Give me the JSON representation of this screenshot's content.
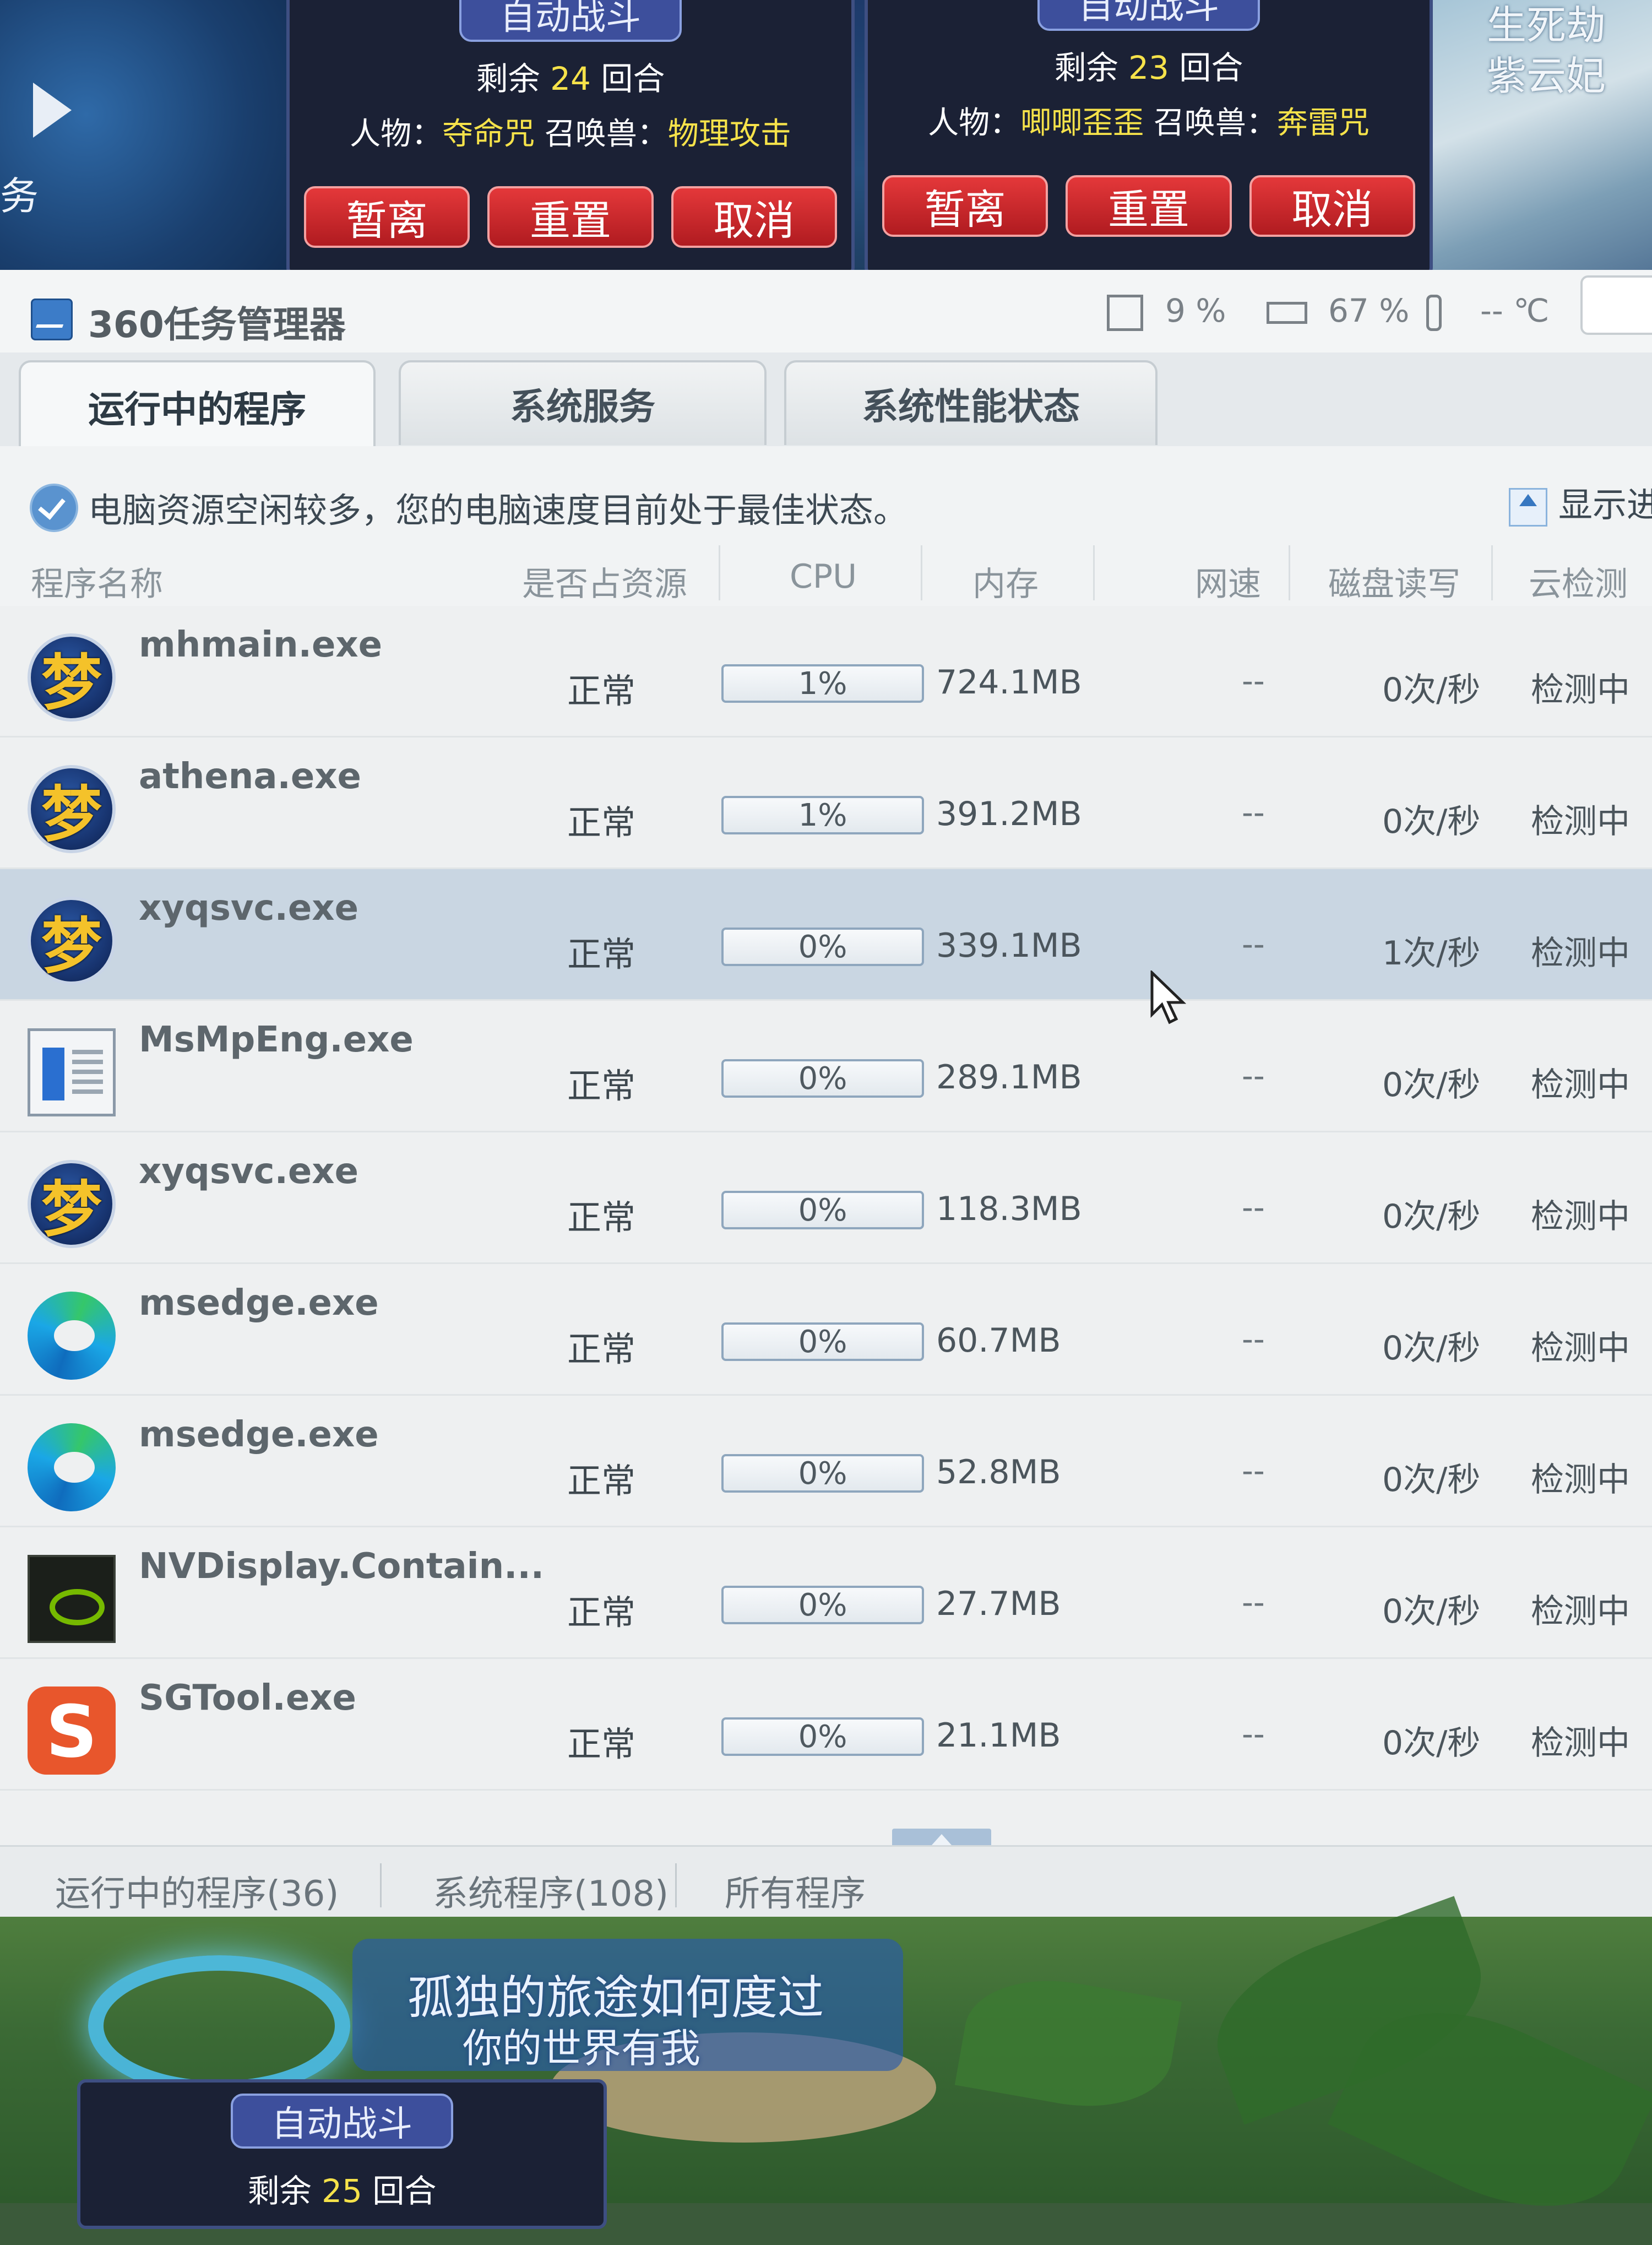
{
  "game": {
    "panel1": {
      "title": "自动战斗",
      "rounds_prefix": "剩余",
      "rounds": "24",
      "rounds_suffix": "回合",
      "char_label": "人物：",
      "char_value": "夺命咒",
      "pet_label": "召唤兽：",
      "pet_value": "物理攻击",
      "buttons": [
        "暂离",
        "重置",
        "取消"
      ]
    },
    "panel2": {
      "title": "自动战斗",
      "rounds_prefix": "剩余",
      "rounds": "23",
      "rounds_suffix": "回合",
      "char_label": "人物：",
      "char_value": "唧唧歪歪",
      "pet_label": "召唤兽：",
      "pet_value": "奔雷咒",
      "buttons": [
        "暂离",
        "重置",
        "取消"
      ]
    },
    "panel3": {
      "title": "自动战斗",
      "rounds_prefix": "剩余",
      "rounds": "25",
      "rounds_suffix": "回合"
    },
    "side_text": "务",
    "corner_text": [
      "生死劫",
      "紫云妃"
    ],
    "bottom_banner": [
      "孤独的旅途如何度过",
      "你的世界有我"
    ]
  },
  "window": {
    "title": "360任务管理器",
    "cpu_usage": "9 %",
    "memory_usage": "67 %",
    "temperature": "-- ℃",
    "tabs": [
      "运行中的程序",
      "系统服务",
      "系统性能状态"
    ],
    "active_tab": 0,
    "status_message": "电脑资源空闲较多，您的电脑速度目前处于最佳状态。",
    "show_toggle": "显示进",
    "columns": [
      "程序名称",
      "是否占资源",
      "CPU",
      "内存",
      "网速",
      "磁盘读写",
      "云检测"
    ],
    "processes": [
      {
        "name": "mhmain.exe",
        "icon": "game-icon",
        "resource": "正常",
        "cpu": "1%",
        "memory": "724.1MB",
        "net": "--",
        "disk": "0次/秒",
        "cloud": "检测中"
      },
      {
        "name": "athena.exe",
        "icon": "game-icon",
        "resource": "正常",
        "cpu": "1%",
        "memory": "391.2MB",
        "net": "--",
        "disk": "0次/秒",
        "cloud": "检测中"
      },
      {
        "name": "xyqsvc.exe",
        "icon": "game-icon",
        "resource": "正常",
        "cpu": "0%",
        "memory": "339.1MB",
        "net": "--",
        "disk": "1次/秒",
        "cloud": "检测中",
        "selected": true
      },
      {
        "name": "MsMpEng.exe",
        "icon": "defender-icon",
        "resource": "正常",
        "cpu": "0%",
        "memory": "289.1MB",
        "net": "--",
        "disk": "0次/秒",
        "cloud": "检测中"
      },
      {
        "name": "xyqsvc.exe",
        "icon": "game-icon",
        "resource": "正常",
        "cpu": "0%",
        "memory": "118.3MB",
        "net": "--",
        "disk": "0次/秒",
        "cloud": "检测中"
      },
      {
        "name": "msedge.exe",
        "icon": "edge-icon",
        "resource": "正常",
        "cpu": "0%",
        "memory": "60.7MB",
        "net": "--",
        "disk": "0次/秒",
        "cloud": "检测中"
      },
      {
        "name": "msedge.exe",
        "icon": "edge-icon",
        "resource": "正常",
        "cpu": "0%",
        "memory": "52.8MB",
        "net": "--",
        "disk": "0次/秒",
        "cloud": "检测中"
      },
      {
        "name": "NVDisplay.Contain...",
        "icon": "nvidia-icon",
        "resource": "正常",
        "cpu": "0%",
        "memory": "27.7MB",
        "net": "--",
        "disk": "0次/秒",
        "cloud": "检测中"
      },
      {
        "name": "SGTool.exe",
        "icon": "sogou-icon",
        "resource": "正常",
        "cpu": "0%",
        "memory": "21.1MB",
        "net": "--",
        "disk": "0次/秒",
        "cloud": "检测中"
      }
    ],
    "footer_tabs": [
      "运行中的程序(36)",
      "系统程序(108)",
      "所有程序"
    ],
    "colors": {
      "selected_row": "#c9d6e2",
      "accent": "#3777c0",
      "button_red": "#d02a2e",
      "highlight_yellow": "#f6e24a"
    }
  }
}
